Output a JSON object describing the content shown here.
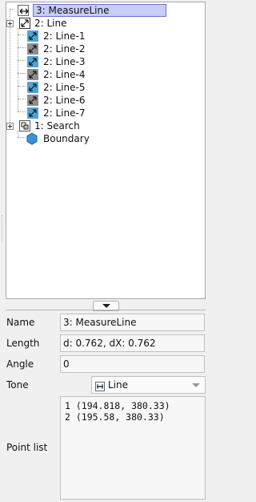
{
  "tree": {
    "items": [
      {
        "label": "3: MeasureLine",
        "icon": "measure-line-icon",
        "selected": true
      },
      {
        "label": "2: Line",
        "icon": "line-group-icon"
      },
      {
        "label": "2: Line-1",
        "icon": "line-icon"
      },
      {
        "label": "2: Line-2",
        "icon": "line-icon"
      },
      {
        "label": "2: Line-3",
        "icon": "line-icon"
      },
      {
        "label": "2: Line-4",
        "icon": "line-icon"
      },
      {
        "label": "2: Line-5",
        "icon": "line-icon"
      },
      {
        "label": "2: Line-6",
        "icon": "line-icon"
      },
      {
        "label": "2: Line-7",
        "icon": "line-icon"
      },
      {
        "label": "1: Search",
        "icon": "search-region-icon"
      },
      {
        "label": "Boundary",
        "icon": "hexagon-icon"
      }
    ]
  },
  "properties": {
    "name_label": "Name",
    "name_value": "3: MeasureLine",
    "length_label": "Length",
    "length_value": "d: 0.762, dX: 0.762",
    "angle_label": "Angle",
    "angle_value": "0",
    "tone_label": "Tone",
    "tone_value": "Line",
    "pointlist_label": "Point list",
    "points": [
      "1 (194.818, 380.33)",
      "2 (195.58, 380.33)"
    ]
  },
  "colors": {
    "selection": "#c8cdf8",
    "icon_blue": "#4fa3d6",
    "icon_gray": "#8d8d8d",
    "hexagon": "#3b92d3"
  }
}
